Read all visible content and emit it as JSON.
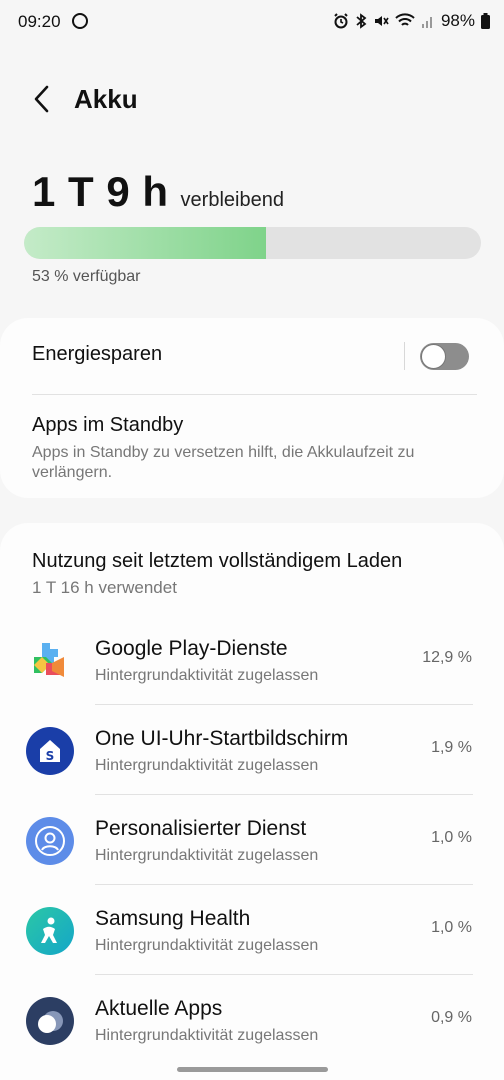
{
  "status": {
    "time": "09:20",
    "battery": "98%"
  },
  "header": {
    "back_icon": "back-arrow-icon",
    "title": "Akku"
  },
  "battery": {
    "remaining": "1 T 9 h",
    "remaining_suffix": "verbleibend",
    "level_fraction": 0.53,
    "available_text": "53 % verfügbar",
    "fill_color": "#7fd38a"
  },
  "settings": {
    "energy_saving_label": "Energiesparen",
    "energy_saving_on": false,
    "standby_title": "Apps im Standby",
    "standby_desc": "Apps in Standby zu versetzen hilft, die Akkulaufzeit zu verlängern."
  },
  "usage": {
    "title": "Nutzung seit letztem vollständigem Laden",
    "subtitle": "1 T 16 h verwendet",
    "apps": [
      {
        "name": "Google Play-Dienste",
        "status": "Hintergrundaktivität zugelassen",
        "percent": "12,9 %",
        "icon": "google-play-services-icon"
      },
      {
        "name": "One UI-Uhr-Startbildschirm",
        "status": "Hintergrundaktivität zugelassen",
        "percent": "1,9 %",
        "icon": "one-ui-watch-icon"
      },
      {
        "name": "Personalisierter Dienst",
        "status": "Hintergrundaktivität zugelassen",
        "percent": "1,0 %",
        "icon": "personalized-service-icon"
      },
      {
        "name": "Samsung Health",
        "status": "Hintergrundaktivität zugelassen",
        "percent": "1,0 %",
        "icon": "samsung-health-icon"
      },
      {
        "name": "Aktuelle Apps",
        "status": "Hintergrundaktivität zugelassen",
        "percent": "0,9 %",
        "icon": "recent-apps-icon"
      }
    ]
  }
}
